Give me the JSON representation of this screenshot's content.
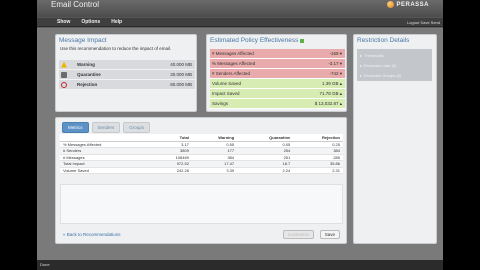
{
  "window": {
    "title": "Email Control",
    "brand": "PERASSA"
  },
  "menu": {
    "items": [
      "Show",
      "Options",
      "Help"
    ],
    "logout": "Logout Save Send"
  },
  "message_impact": {
    "title": "Message Impact",
    "description": "Use this recommendation to reduce the impact of email.",
    "rows": [
      {
        "label": "Warning",
        "value": "40.000 MB",
        "icon": "warning-icon"
      },
      {
        "label": "Quarantine",
        "value": "30.000 MB",
        "icon": "quarantine-icon"
      },
      {
        "label": "Rejection",
        "value": "80.000 MB",
        "icon": "reject-icon"
      }
    ]
  },
  "effectiveness": {
    "title": "Estimated Policy Effectiveness",
    "rows": [
      {
        "label": "# Messages Affected",
        "value": "-169 ▾",
        "tone": "red"
      },
      {
        "label": "% Messages Affected",
        "value": "-3.17 ▾",
        "tone": "red"
      },
      {
        "label": "# Senders Affected",
        "value": "-742 ▾",
        "tone": "red"
      },
      {
        "label": "Volume Saved",
        "value": "1.39 GB ▴",
        "tone": "green"
      },
      {
        "label": "Impact Saved",
        "value": "71.78 GB ▴",
        "tone": "green"
      },
      {
        "label": "Savings",
        "value": "$ 13,032.87 ▴",
        "tone": "green"
      }
    ]
  },
  "restriction": {
    "title": "Restriction Details",
    "items": [
      "Thresholds",
      "Exclusion Lists (0)",
      "Exclusion Groups (0)"
    ]
  },
  "tabs": [
    "Metrics",
    "Senders",
    "Groups"
  ],
  "table": {
    "headers": [
      "",
      "Total",
      "Warning",
      "Quarantine",
      "Rejection"
    ],
    "rows": [
      [
        "% Messages Affected",
        "3.17",
        "0.55",
        "0.05",
        "0.25"
      ],
      [
        "# Senders",
        "3809",
        "177",
        "254",
        "384"
      ],
      [
        "# Messages",
        "108469",
        "384",
        "251",
        "285"
      ],
      [
        "Total Impact",
        "972.52",
        "17.47",
        "18.7",
        "35.86"
      ],
      [
        "Volume Saved",
        "242.26",
        "3.39",
        "2.24",
        "2.31"
      ]
    ]
  },
  "footer": {
    "back": "« Back to Recommendations",
    "disabled_btn": "Customize",
    "save": "Save"
  },
  "status": {
    "text": "Done"
  }
}
